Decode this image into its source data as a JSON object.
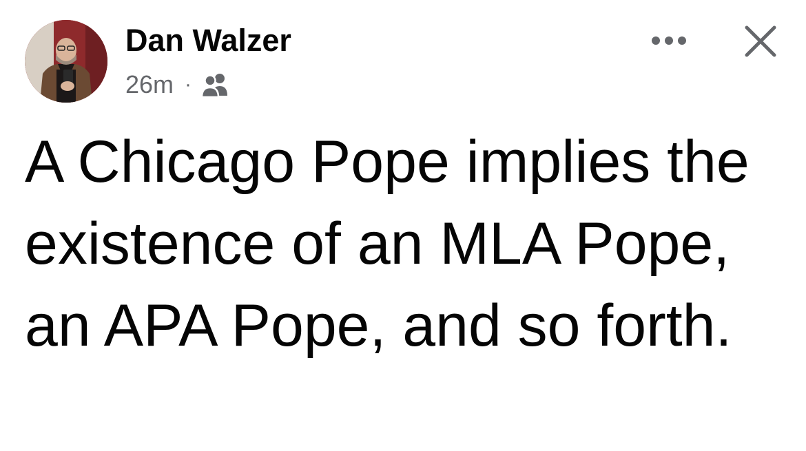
{
  "post": {
    "author": {
      "name": "Dan Walzer",
      "avatar_icon": "profile-photo"
    },
    "timestamp": "26m",
    "separator": "·",
    "audience_icon": "friends-icon",
    "actions": {
      "more_icon": "more-options-icon",
      "close_icon": "close-icon"
    },
    "text": "A Chicago Pope implies the existence of an MLA Pope, an APA Pope, and so forth."
  },
  "colors": {
    "text_primary": "#050505",
    "text_secondary": "#65676b",
    "background": "#ffffff"
  }
}
